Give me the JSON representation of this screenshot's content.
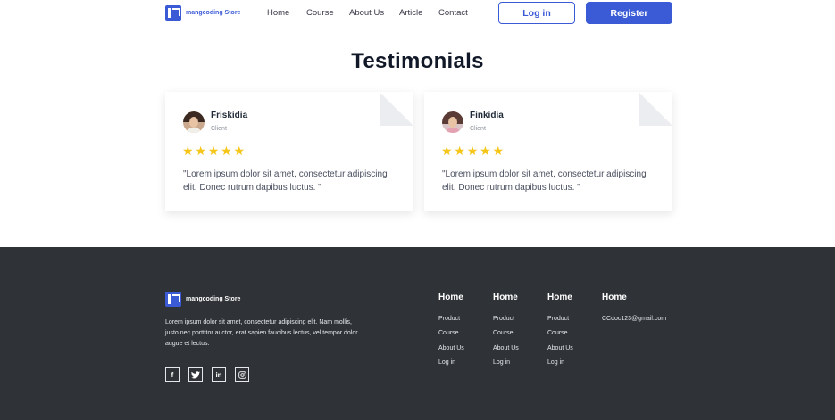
{
  "nav": {
    "brand": "mangcoding Store",
    "links": [
      "Home",
      "Course",
      "About Us",
      "Article",
      "Contact"
    ],
    "login_label": "Log in",
    "register_label": "Register"
  },
  "testimonials": {
    "title": "Testimonials",
    "items": [
      {
        "name": "Friskidia",
        "role": "Client",
        "rating": 5,
        "quote": "\"Lorem ipsum dolor sit amet, consectetur adipiscing elit. Donec rutrum dapibus luctus. \""
      },
      {
        "name": "Finkidia",
        "role": "Client",
        "rating": 5,
        "quote": "\"Lorem ipsum dolor sit amet, consectetur adipiscing elit. Donec rutrum dapibus luctus. \""
      }
    ]
  },
  "footer": {
    "brand": "mangcoding Store",
    "description": "Lorem ipsum dolor sit amet, consectetur adipiscing elit. Nam mollis, justo nec porttitor auctor, erat sapien faucibus lectus, vel tempor dolor augue et lectus.",
    "social": [
      {
        "icon": "facebook-icon",
        "glyph": "f"
      },
      {
        "icon": "twitter-icon",
        "glyph": "t"
      },
      {
        "icon": "linkedin-icon",
        "glyph": "in"
      },
      {
        "icon": "instagram-icon",
        "glyph": "ig"
      }
    ],
    "columns": [
      {
        "title": "Home",
        "links": [
          "Product",
          "Course",
          "About Us",
          "Log in"
        ]
      },
      {
        "title": "Home",
        "links": [
          "Product",
          "Course",
          "About Us",
          "Log in"
        ]
      },
      {
        "title": "Home",
        "links": [
          "Product",
          "Course",
          "About Us",
          "Log in"
        ]
      },
      {
        "title": "Home",
        "links": [
          "CCdoc123@gmail.com"
        ]
      }
    ]
  },
  "colors": {
    "accent": "#3b5bd6",
    "footer_bg": "#2f3337",
    "star": "#f5c518"
  }
}
